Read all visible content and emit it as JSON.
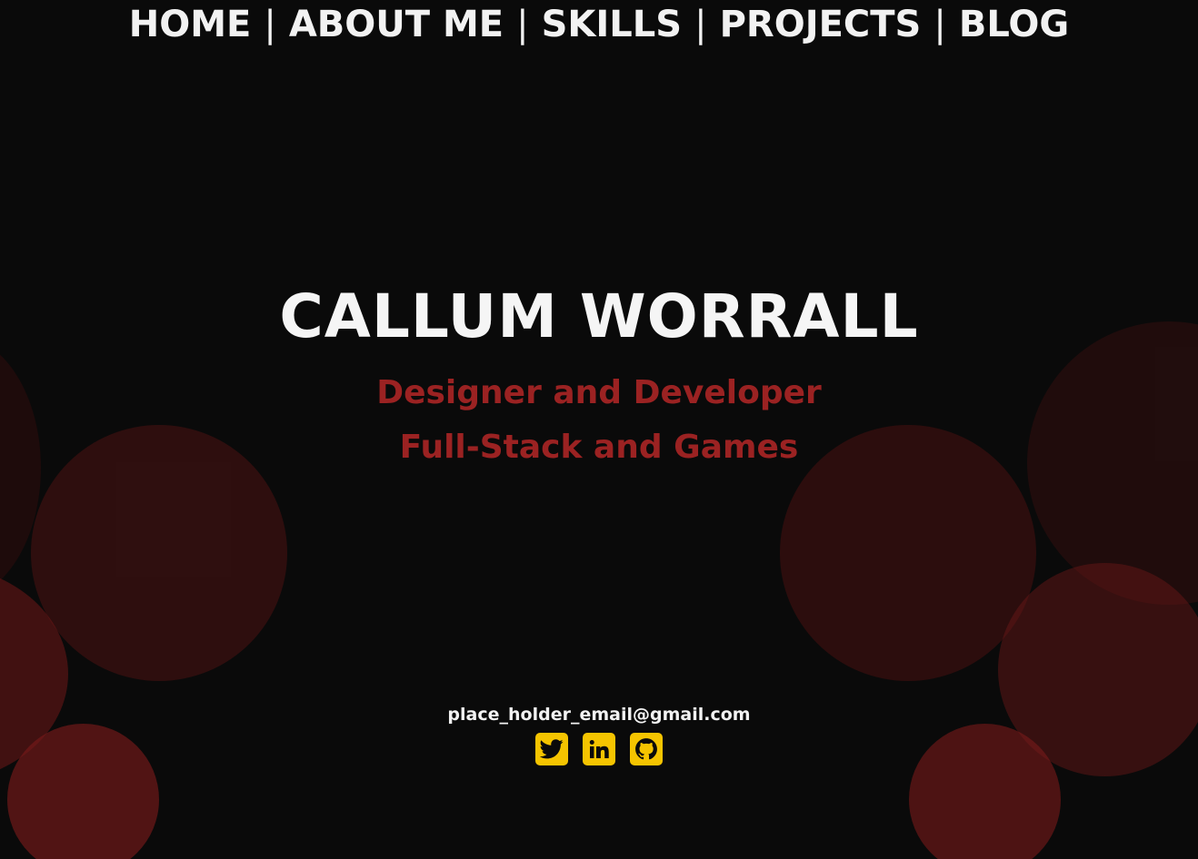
{
  "nav": {
    "items": [
      {
        "label": "HOME"
      },
      {
        "label": "ABOUT ME"
      },
      {
        "label": "SKILLS"
      },
      {
        "label": "PROJECTS"
      },
      {
        "label": "BLOG"
      }
    ],
    "separator": "|"
  },
  "hero": {
    "name": "CALLUM WORRALL",
    "subtitle_line1": "Designer and Developer",
    "subtitle_line2": "Full-Stack and Games"
  },
  "contact": {
    "email": "place_holder_email@gmail.com",
    "socials": [
      {
        "icon": "twitter-icon"
      },
      {
        "icon": "linkedin-icon"
      },
      {
        "icon": "github-icon"
      }
    ]
  },
  "colors": {
    "background": "#0a0a0a",
    "accent_red": "#9b2222",
    "social_yellow": "#f5c400",
    "text_white": "#f2f2f2"
  }
}
